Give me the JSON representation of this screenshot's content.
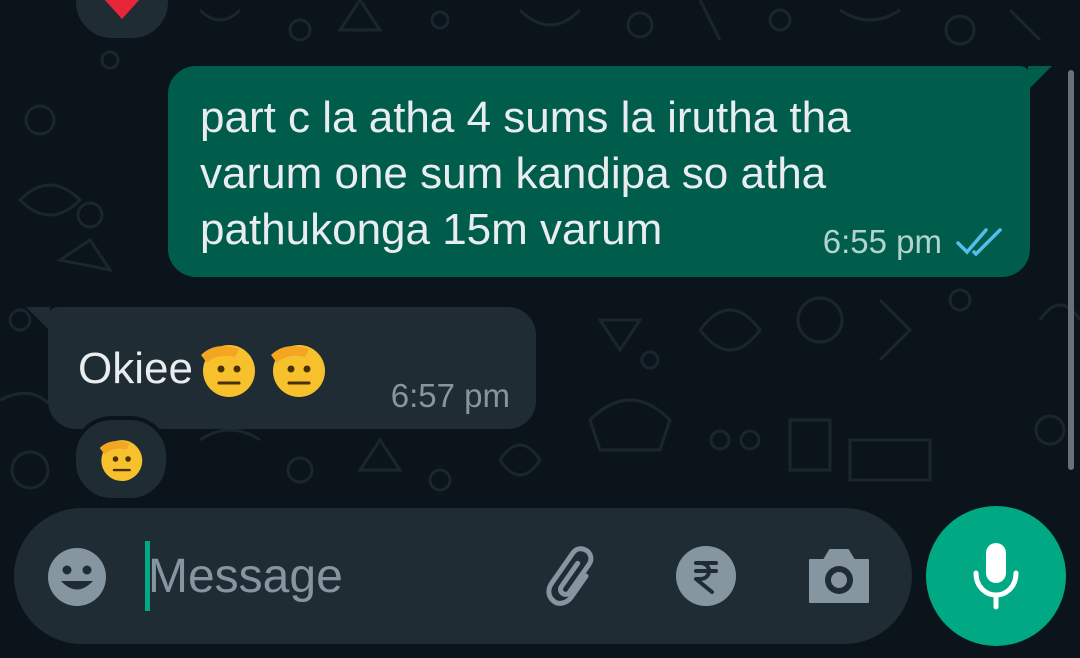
{
  "messages": [
    {
      "direction": "outgoing",
      "text": "part c la atha 4 sums la irutha tha varum one sum kandipa so atha pathukonga 15m varum",
      "time": "6:55 pm",
      "status": "double-tick-read",
      "status_color": "#53bdeb"
    },
    {
      "direction": "incoming",
      "text": "Okiee",
      "emojis": [
        "saluting-face",
        "saluting-face"
      ],
      "time": "6:57 pm",
      "reaction": "saluting-face"
    }
  ],
  "previous_reaction": "red-heart",
  "composer": {
    "placeholder": "Message",
    "icons": [
      "emoji-icon",
      "paperclip-icon",
      "rupee-icon",
      "camera-icon"
    ],
    "send_icon": "mic-icon"
  },
  "colors": {
    "background": "#0b141a",
    "outgoing_bubble": "#005c4b",
    "incoming_bubble": "#1f2c34",
    "accent": "#00a884"
  }
}
